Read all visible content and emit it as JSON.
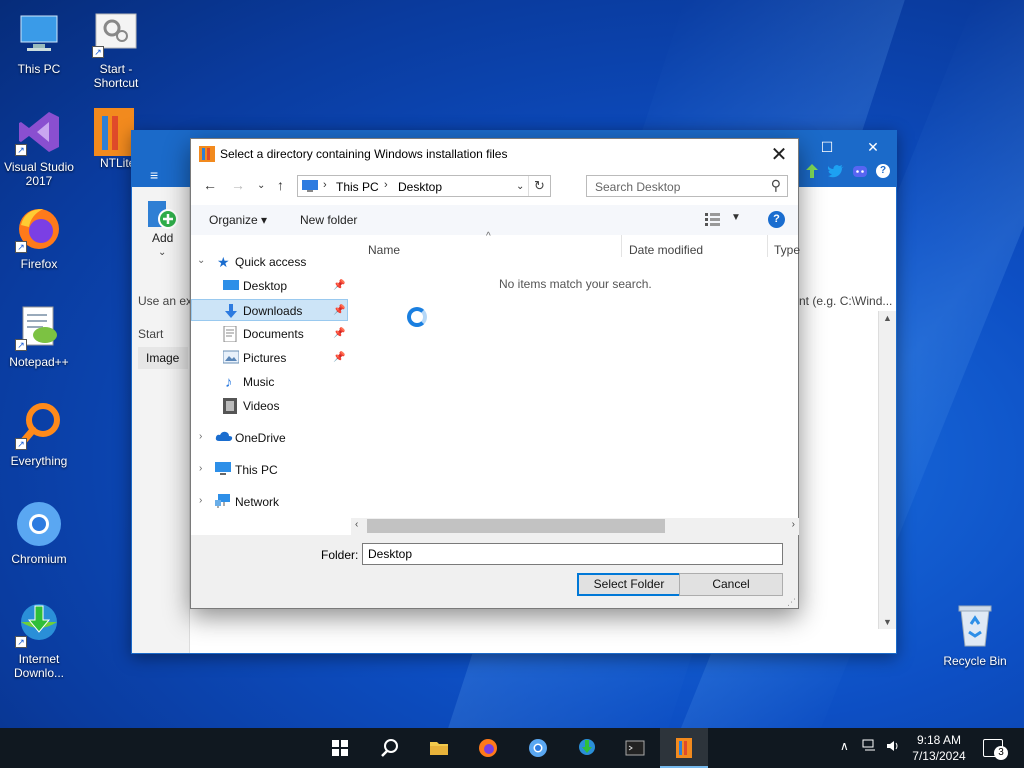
{
  "desktop": {
    "icons": [
      {
        "label": "This PC",
        "icon": "this-pc-icon"
      },
      {
        "label": "Start - Shortcut",
        "icon": "settings-shortcut-icon"
      },
      {
        "label": "Visual Studio 2017",
        "icon": "visual-studio-icon"
      },
      {
        "label": "NTLite",
        "icon": "ntlite-icon"
      },
      {
        "label": "Firefox",
        "icon": "firefox-icon"
      },
      {
        "label": "Notepad++",
        "icon": "notepad-plus-plus-icon"
      },
      {
        "label": "Everything",
        "icon": "everything-search-icon"
      },
      {
        "label": "Chromium",
        "icon": "chromium-icon"
      },
      {
        "label": "Internet Downlo...",
        "icon": "internet-download-manager-icon"
      },
      {
        "label": "Recycle Bin",
        "icon": "recycle-bin-icon"
      }
    ]
  },
  "ntlite": {
    "add_label": "Add",
    "hint_left": "Use an ex",
    "hint_right": "nt (e.g. C:\\Wind...",
    "start_label": "Start",
    "image_label": "Image",
    "title_close": "✕",
    "title_max": "☐"
  },
  "dialog": {
    "title": "Select a directory containing Windows installation files",
    "close_glyph": "✕",
    "address": {
      "segments": [
        "This PC",
        "Desktop"
      ]
    },
    "search_placeholder": "Search Desktop",
    "toolbar": {
      "organize": "Organize ▾",
      "new_folder": "New folder",
      "help": "?"
    },
    "nav": {
      "quick_access": "Quick access",
      "quick_items": [
        {
          "label": "Desktop",
          "pinned": true
        },
        {
          "label": "Downloads",
          "pinned": true,
          "selected": true
        },
        {
          "label": "Documents",
          "pinned": true
        },
        {
          "label": "Pictures",
          "pinned": true
        },
        {
          "label": "Music",
          "pinned": false
        },
        {
          "label": "Videos",
          "pinned": false
        }
      ],
      "roots": [
        "OneDrive",
        "This PC",
        "Network"
      ]
    },
    "columns": [
      "Name",
      "Date modified",
      "Type"
    ],
    "empty_message": "No items match your search.",
    "folder_label": "Folder:",
    "folder_value": "Desktop",
    "select_button": "Select Folder",
    "cancel_button": "Cancel"
  },
  "taskbar": {
    "clock_time": "9:18 AM",
    "clock_date": "7/13/2024",
    "notification_count": "3"
  },
  "colors": {
    "accent": "#1b6ac9",
    "selection": "#cce4f7",
    "taskbar": "#101820"
  }
}
